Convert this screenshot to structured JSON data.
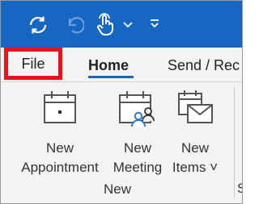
{
  "qat": {
    "sync_icon": "sync-icon",
    "undo_icon": "undo-icon",
    "touch_icon": "touch-mode-icon",
    "dropdown_icon": "chevron-down-icon",
    "customize_icon": "customize-qat-icon"
  },
  "tabs": [
    {
      "label": "File",
      "highlighted": true
    },
    {
      "label": "Home",
      "selected": true
    },
    {
      "label": "Send / Rec"
    }
  ],
  "ribbon": {
    "buttons": [
      {
        "line1": "New",
        "line2": "Appointment",
        "icon": "calendar-icon"
      },
      {
        "line1": "New",
        "line2": "Meeting",
        "icon": "meeting-calendar-icon"
      },
      {
        "line1": "New",
        "line2": "Items ˅",
        "icon": "new-items-icon"
      }
    ],
    "group_label": "New",
    "next_group_cut": "S"
  },
  "colors": {
    "titlebar": "#1666c2",
    "highlight_border": "#e8121b",
    "tab_underline": "#1a66c4",
    "ribbon_bg": "#f3f3f3"
  }
}
